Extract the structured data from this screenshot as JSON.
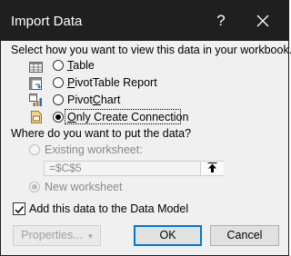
{
  "window": {
    "title": "Import Data",
    "help_symbol": "?"
  },
  "view_section": {
    "prompt": "Select how you want to view this data in your workbook.",
    "options": [
      {
        "label_first": "T",
        "label_rest": "able",
        "selected": false,
        "icon": "table-icon"
      },
      {
        "label_first": "P",
        "label_rest": "ivotTable Report",
        "selected": false,
        "icon": "pivottable-icon"
      },
      {
        "label_pre": "Pivot",
        "label_first": "C",
        "label_rest": "hart",
        "selected": false,
        "icon": "pivotchart-icon"
      },
      {
        "label_first": "O",
        "label_rest": "nly Create Connection",
        "selected": true,
        "icon": "connection-icon"
      }
    ]
  },
  "location_section": {
    "prompt": "Where do you want to put the data?",
    "existing_label": "Existing worksheet:",
    "existing_selected": false,
    "cell_reference": "=$C$5",
    "new_label": "New worksheet",
    "new_selected": true
  },
  "data_model": {
    "label": "Add this data to the Data Model",
    "checked": true
  },
  "buttons": {
    "properties": "Properties...",
    "ok": "OK",
    "cancel": "Cancel"
  },
  "colors": {
    "titlebar": "#1f1f1f",
    "accent": "#0078d7",
    "disabled_text": "#8a8a8a"
  }
}
